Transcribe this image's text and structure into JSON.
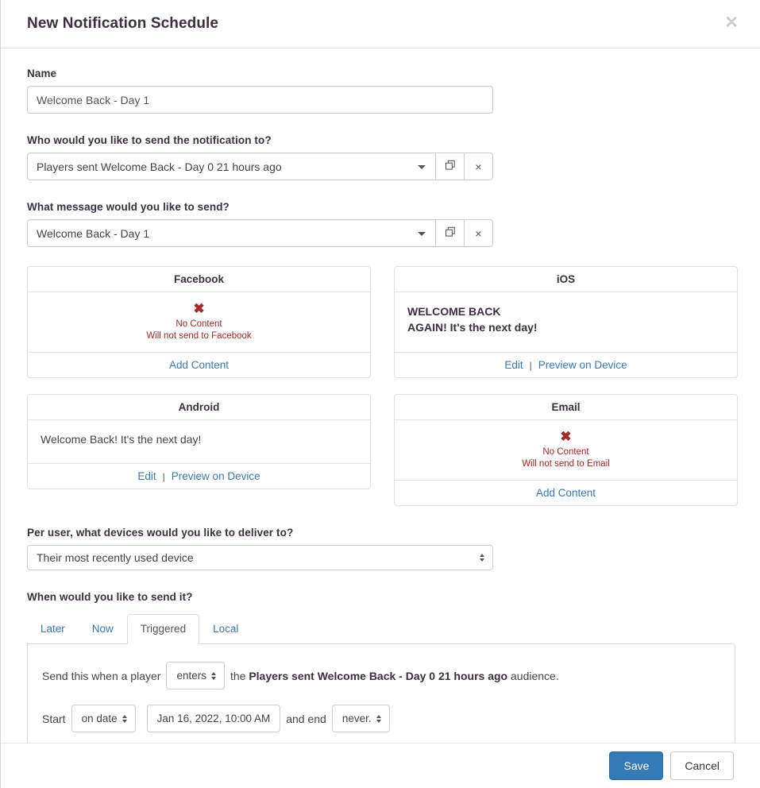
{
  "header": {
    "title": "New Notification Schedule",
    "close_icon": "close-icon",
    "close_glyph": "✕"
  },
  "name_field": {
    "label": "Name",
    "value": "Welcome Back - Day 1",
    "placeholder": "Name"
  },
  "audience_field": {
    "label": "Who would you like to send the notification to?",
    "value": "Players sent Welcome Back - Day 0 21 hours ago",
    "copy_icon": "copy-icon",
    "clear_icon": "clear-icon",
    "clear_glyph": "×"
  },
  "message_field": {
    "label": "What message would you like to send?",
    "value": "Welcome Back - Day 1",
    "copy_icon": "copy-icon",
    "clear_icon": "clear-icon",
    "clear_glyph": "×"
  },
  "channels": [
    {
      "name": "facebook",
      "title": "Facebook",
      "state": "empty",
      "x_glyph": "✖",
      "no_content": "No Content",
      "will_not_send": "Will not send to Facebook",
      "action": "Add Content"
    },
    {
      "name": "ios",
      "title": "iOS",
      "state": "filled",
      "line1": "WELCOME BACK",
      "line2": "AGAIN! It's the next day!",
      "edit": "Edit",
      "separator": "|",
      "preview": "Preview on Device"
    },
    {
      "name": "android",
      "title": "Android",
      "state": "filled",
      "line1": "Welcome Back! It's the next day!",
      "edit": "Edit",
      "separator": "|",
      "preview": "Preview on Device"
    },
    {
      "name": "email",
      "title": "Email",
      "state": "empty",
      "x_glyph": "✖",
      "no_content": "No Content",
      "will_not_send": "Will not send to Email",
      "action": "Add Content"
    }
  ],
  "devices_field": {
    "label": "Per user, what devices would you like to deliver to?",
    "value": "Their most recently used device"
  },
  "when_field": {
    "label": "When would you like to send it?",
    "tabs": [
      {
        "label": "Later",
        "active": false
      },
      {
        "label": "Now",
        "active": false
      },
      {
        "label": "Triggered",
        "active": true
      },
      {
        "label": "Local",
        "active": false
      }
    ]
  },
  "triggered": {
    "lead_text": "Send this when a player",
    "trigger_event": "enters",
    "mid_text": "the",
    "audience_name": "Players sent Welcome Back - Day 0 21 hours ago",
    "tail_text": "audience.",
    "start_label": "Start",
    "start_mode": "on date",
    "start_datetime": "Jan 16, 2022, 10:00 AM",
    "and_end_label": "and end",
    "end_mode": "never."
  },
  "footer": {
    "save_label": "Save",
    "cancel_label": "Cancel"
  },
  "colors": {
    "accent_blue": "#337ab7",
    "danger_red": "#ab2525",
    "heading": "#3c2f3f",
    "border": "#e0e0e0"
  }
}
